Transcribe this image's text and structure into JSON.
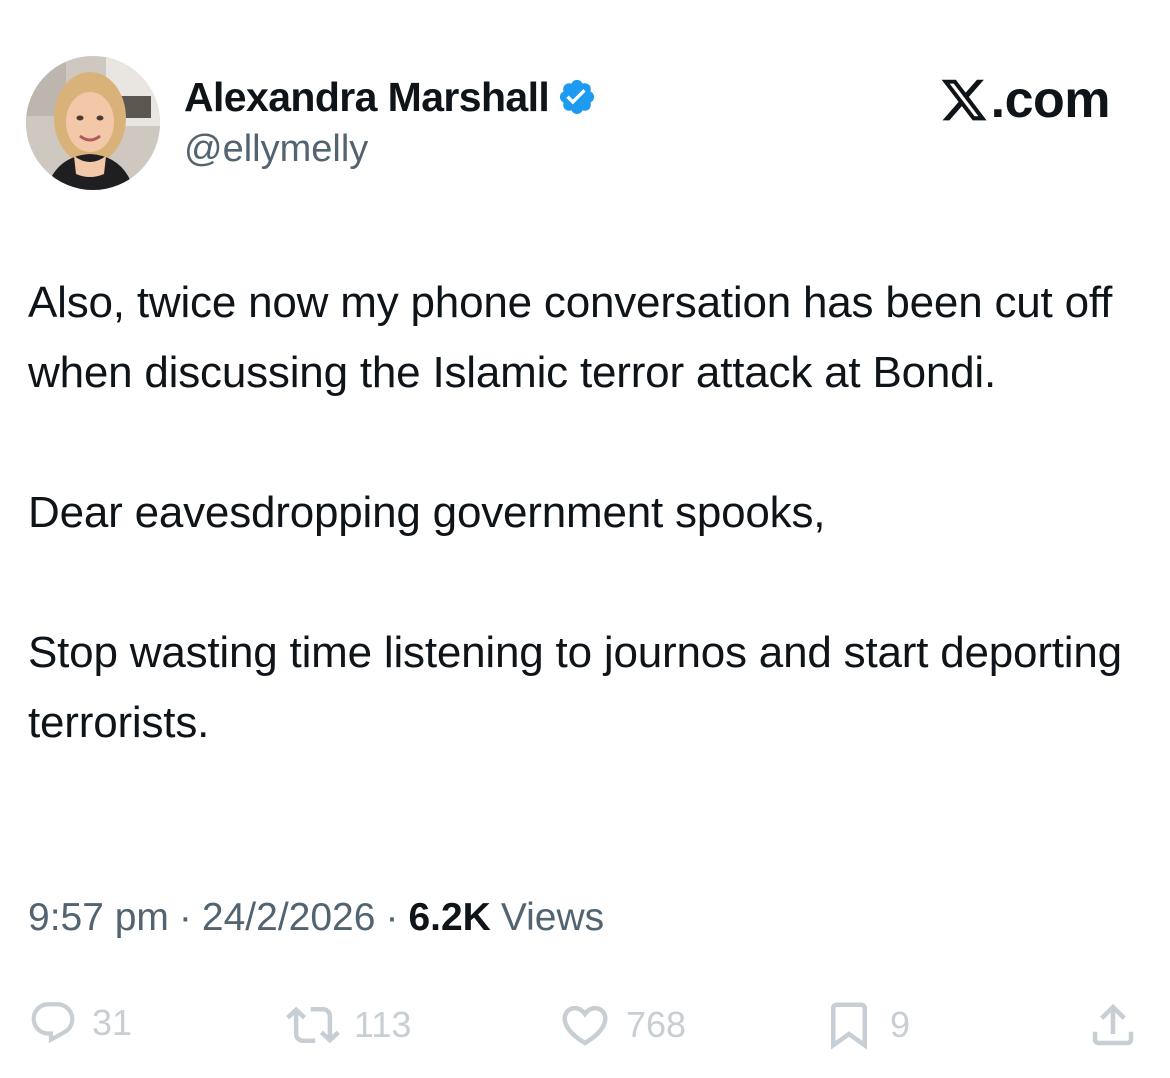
{
  "author": {
    "display_name": "Alexandra Marshall",
    "handle": "@ellymelly",
    "verified_icon": "verified-badge-icon",
    "verified_color": "#1d9bf0"
  },
  "brand": {
    "label": ".com",
    "logo_icon": "x-logo-icon"
  },
  "tweet": {
    "paragraphs": [
      "Also, twice now my phone conversation has been cut off when discussing the Islamic terror attack at Bondi.",
      "Dear eavesdropping government spooks,",
      "Stop wasting time listening to journos and start deporting terrorists."
    ]
  },
  "meta": {
    "time": "9:57 pm",
    "separator": "·",
    "date": "24/2/2026",
    "views_count": "6.2K",
    "views_label": "Views"
  },
  "actions": {
    "replies": {
      "icon": "reply-icon",
      "count": "31"
    },
    "reposts": {
      "icon": "repost-icon",
      "count": "113"
    },
    "likes": {
      "icon": "heart-icon",
      "count": "768"
    },
    "bookmarks": {
      "icon": "bookmark-icon",
      "count": "9"
    },
    "share": {
      "icon": "share-icon"
    }
  },
  "colors": {
    "text_primary": "#0f1419",
    "text_secondary": "#536471",
    "action_gray": "#c7ced4"
  }
}
